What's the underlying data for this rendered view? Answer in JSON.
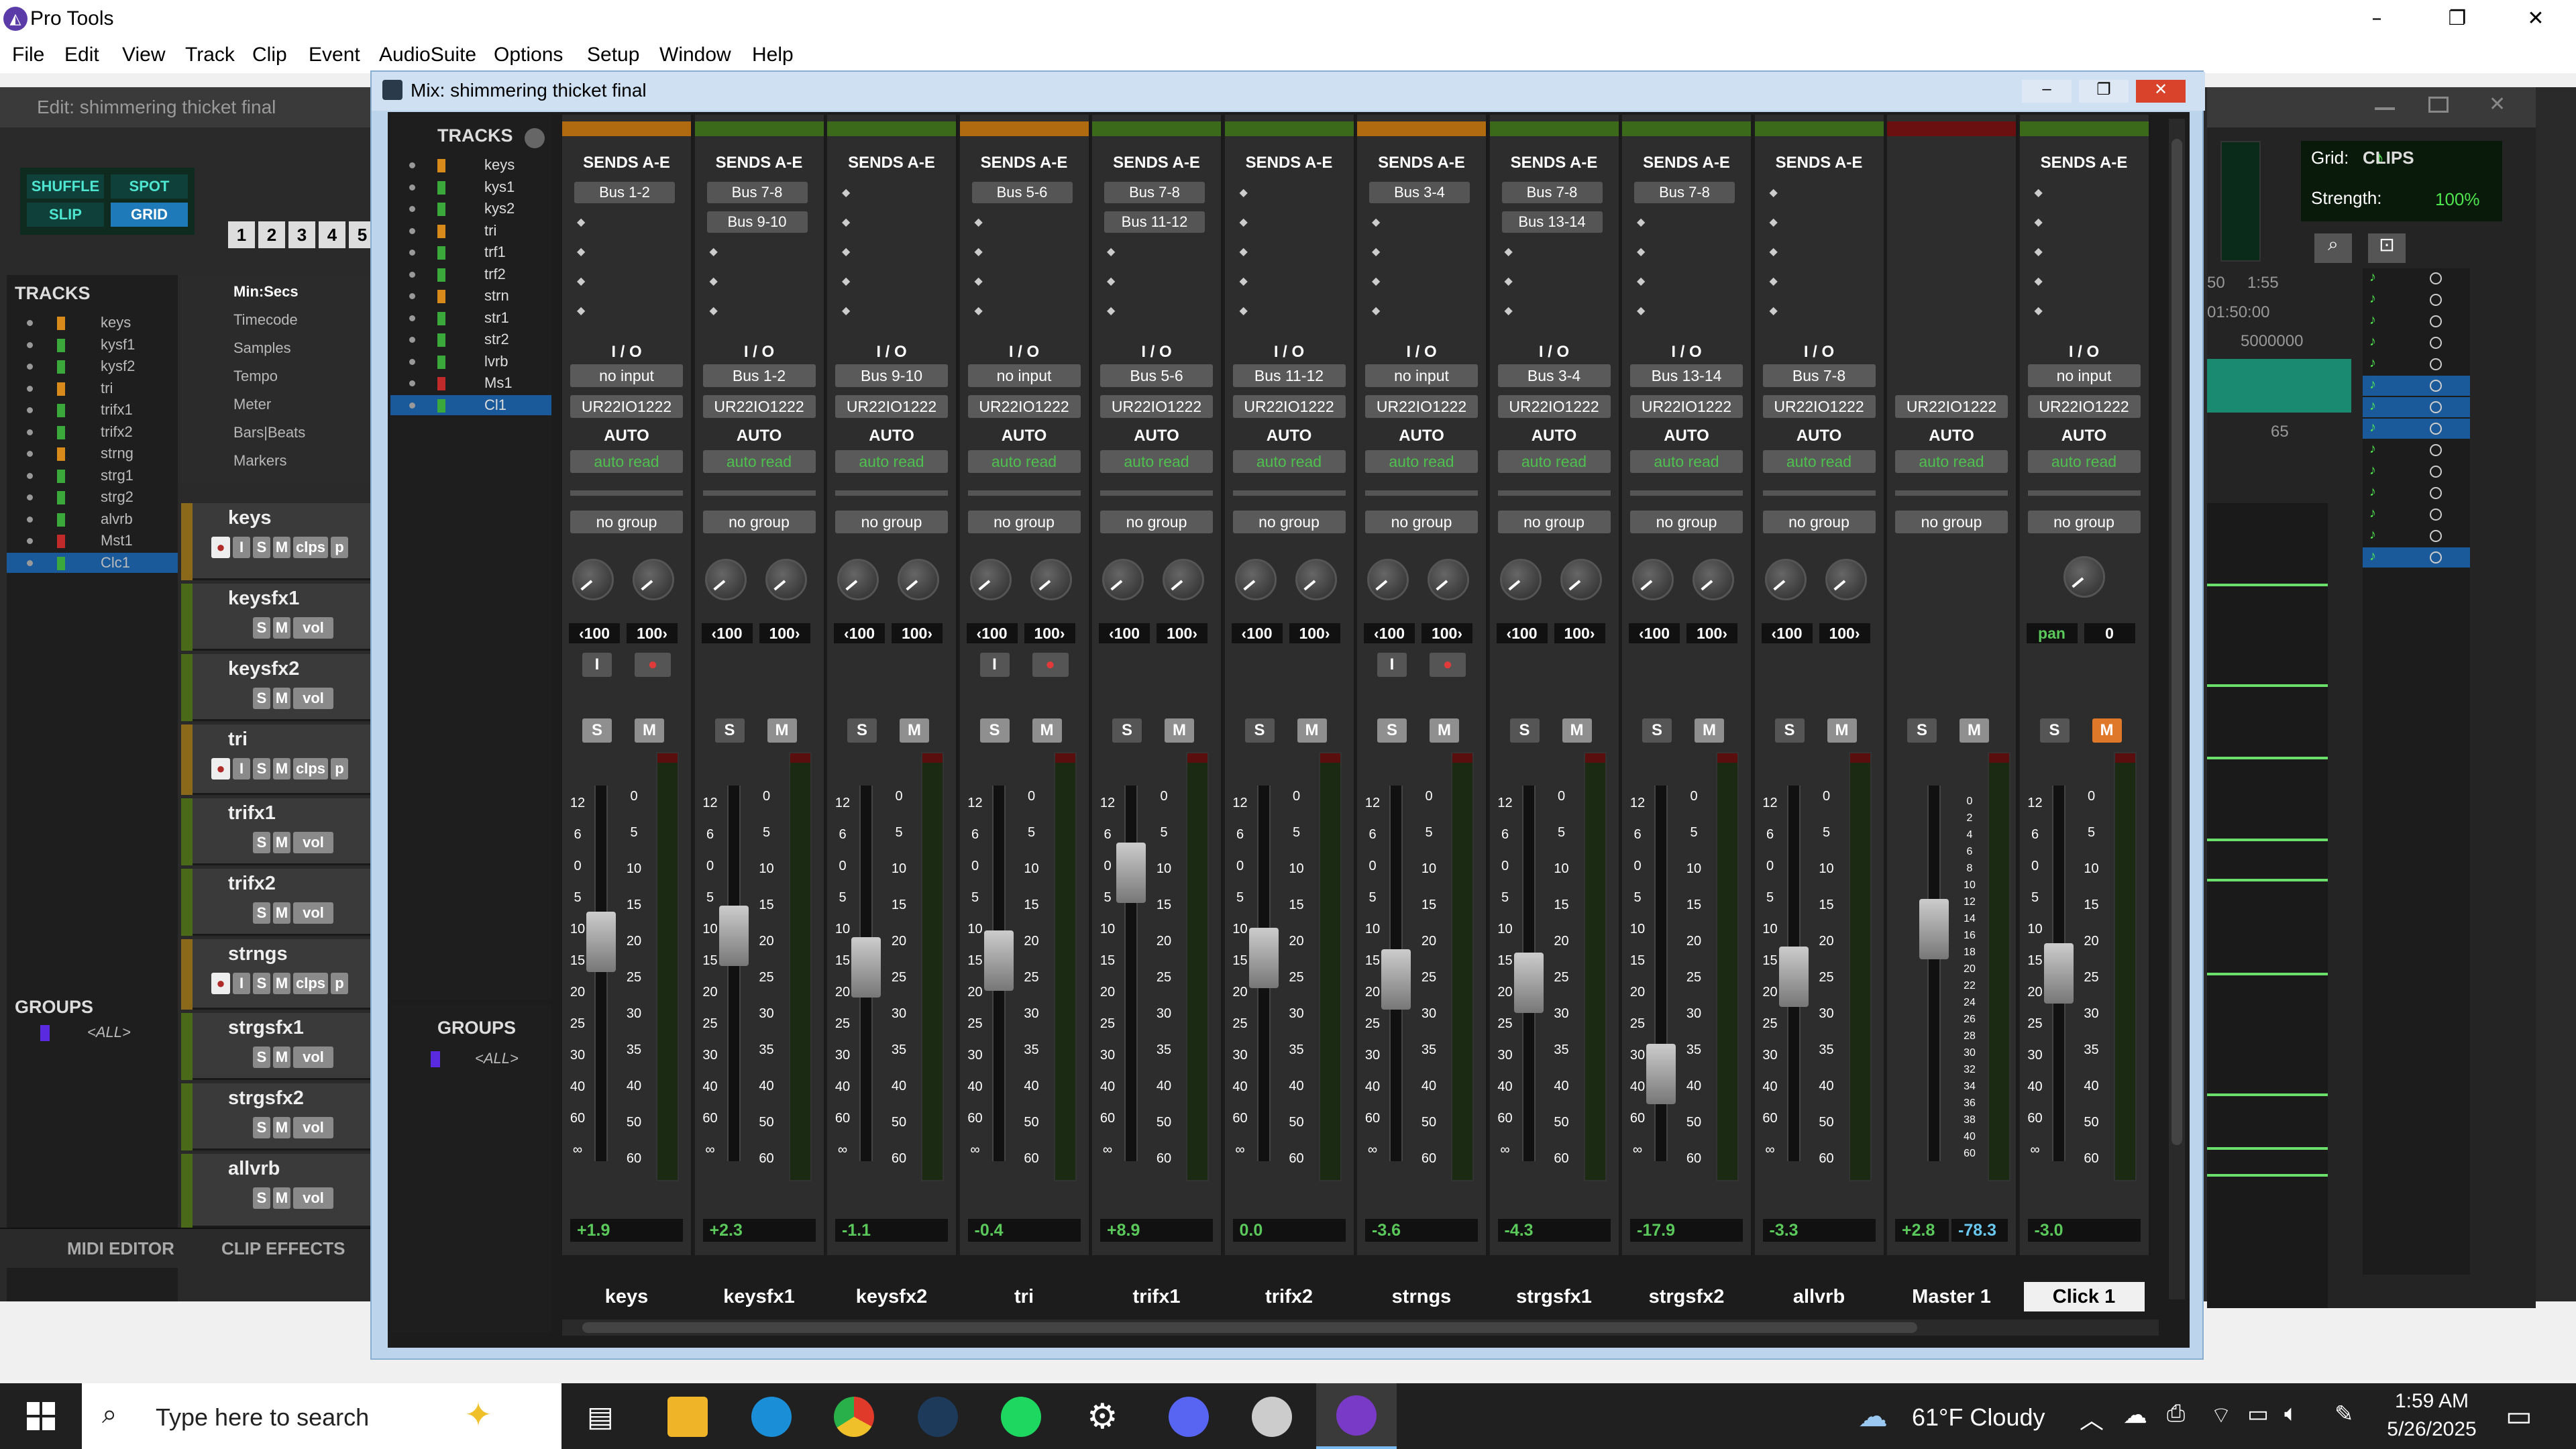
{
  "app": {
    "title": "Pro Tools",
    "edit_title": "Edit: shimmering thicket final",
    "mix_title": "Mix: shimmering thicket final"
  },
  "menu": [
    "File",
    "Edit",
    "View",
    "Track",
    "Clip",
    "Event",
    "AudioSuite",
    "Options",
    "Setup",
    "Window",
    "Help"
  ],
  "edit": {
    "modes": [
      "SHUFFLE",
      "SPOT",
      "SLIP",
      "GRID"
    ],
    "counts": [
      "1",
      "2",
      "3",
      "4",
      "5"
    ],
    "tracks_header": "TRACKS",
    "groups_header": "GROUPS",
    "group_all": "<ALL>",
    "left_tracks": [
      "keys",
      "kysf1",
      "kysf2",
      "tri",
      "trifx1",
      "trifx2",
      "strng",
      "strg1",
      "strg2",
      "alvrb",
      "Mst1",
      "Clc1"
    ],
    "rulers": [
      "Min:Secs",
      "Timecode",
      "Samples",
      "Tempo",
      "Meter",
      "Bars|Beats",
      "Markers"
    ],
    "track_names": [
      "keys",
      "keysfx1",
      "keysfx2",
      "tri",
      "trifx1",
      "trifx2",
      "strngs",
      "strgsfx1",
      "strgsfx2",
      "allvrb"
    ],
    "grid_label": "Grid:",
    "strength_label": "Strength:",
    "strength_value": "100%",
    "time_vals": [
      "1:55",
      "50",
      "01:50:00",
      "5000000",
      "65"
    ],
    "clips_header": "CLIPS",
    "bottom_tabs": [
      "MIDI EDITOR",
      "CLIP EFFECTS"
    ],
    "button_labels": {
      "i": "I",
      "s": "S",
      "m": "M",
      "clips": "clps",
      "p": "p",
      "vol": "vol"
    }
  },
  "mix": {
    "tracks_header": "TRACKS",
    "groups_header": "GROUPS",
    "group_all": "<ALL>",
    "tracks": [
      "keys",
      "kys1",
      "kys2",
      "tri",
      "trf1",
      "trf2",
      "strn",
      "str1",
      "str2",
      "lvrb",
      "Ms1",
      "Cl1"
    ],
    "sends_label": "SENDS A-E",
    "io_label": "I / O",
    "auto_label": "AUTO",
    "scale": [
      "12",
      "6",
      "0",
      "5",
      "10",
      "15",
      "20",
      "25",
      "30",
      "40",
      "60",
      "∞"
    ],
    "scale_right": [
      "0",
      "5",
      "10",
      "15",
      "20",
      "25",
      "30",
      "35",
      "40",
      "50",
      "60"
    ],
    "master_scale": [
      "0",
      "2",
      "4",
      "6",
      "8",
      "10",
      "12",
      "14",
      "16",
      "18",
      "20",
      "22",
      "24",
      "26",
      "28",
      "30",
      "32",
      "34",
      "36",
      "38",
      "40",
      "60"
    ],
    "strips": [
      {
        "name": "keys",
        "color": "#b06a10",
        "sends": [
          "Bus 1-2"
        ],
        "input": "no input",
        "output": "UR22IO1222",
        "auto": "auto read",
        "group": "no group",
        "pan_l": "‹100",
        "pan_r": "100›",
        "vol": "+1.9",
        "rec": true,
        "fader": 0.4
      },
      {
        "name": "keysfx1",
        "color": "#3a6a1a",
        "sends": [
          "Bus 7-8",
          "Bus 9-10"
        ],
        "input": "Bus 1-2",
        "output": "UR22IO1222",
        "auto": "auto read",
        "group": "no group",
        "pan_l": "‹100",
        "pan_r": "100›",
        "vol": "+2.3",
        "rec": false,
        "fader": 0.38
      },
      {
        "name": "keysfx2",
        "color": "#3a6a1a",
        "sends": [],
        "input": "Bus 9-10",
        "output": "UR22IO1222",
        "auto": "auto read",
        "group": "no group",
        "pan_l": "‹100",
        "pan_r": "100›",
        "vol": "-1.1",
        "rec": false,
        "fader": 0.48
      },
      {
        "name": "tri",
        "color": "#b06a10",
        "sends": [
          "Bus 5-6"
        ],
        "input": "no input",
        "output": "UR22IO1222",
        "auto": "auto read",
        "group": "no group",
        "pan_l": "‹100",
        "pan_r": "100›",
        "vol": "-0.4",
        "rec": true,
        "fader": 0.46
      },
      {
        "name": "trifx1",
        "color": "#3a6a1a",
        "sends": [
          "Bus 7-8",
          "Bus 11-12"
        ],
        "input": "Bus 5-6",
        "output": "UR22IO1222",
        "auto": "auto read",
        "group": "no group",
        "pan_l": "‹100",
        "pan_r": "100›",
        "vol": "+8.9",
        "rec": false,
        "fader": 0.18
      },
      {
        "name": "trifx2",
        "color": "#3a6a1a",
        "sends": [],
        "input": "Bus 11-12",
        "output": "UR22IO1222",
        "auto": "auto read",
        "group": "no group",
        "pan_l": "‹100",
        "pan_r": "100›",
        "vol": "0.0",
        "rec": false,
        "fader": 0.45
      },
      {
        "name": "strngs",
        "color": "#b06a10",
        "sends": [
          "Bus 3-4"
        ],
        "input": "no input",
        "output": "UR22IO1222",
        "auto": "auto read",
        "group": "no group",
        "pan_l": "‹100",
        "pan_r": "100›",
        "vol": "-3.6",
        "rec": true,
        "fader": 0.52
      },
      {
        "name": "strgsfx1",
        "color": "#3a6a1a",
        "sends": [
          "Bus 7-8",
          "Bus 13-14"
        ],
        "input": "Bus 3-4",
        "output": "UR22IO1222",
        "auto": "auto read",
        "group": "no group",
        "pan_l": "‹100",
        "pan_r": "100›",
        "vol": "-4.3",
        "rec": false,
        "fader": 0.53
      },
      {
        "name": "strgsfx2",
        "color": "#3a6a1a",
        "sends": [
          "Bus 7-8"
        ],
        "input": "Bus 13-14",
        "output": "UR22IO1222",
        "auto": "auto read",
        "group": "no group",
        "pan_l": "‹100",
        "pan_r": "100›",
        "vol": "-17.9",
        "rec": false,
        "fader": 0.82
      },
      {
        "name": "allvrb",
        "color": "#3a6a1a",
        "sends": [],
        "input": "Bus 7-8",
        "output": "UR22IO1222",
        "auto": "auto read",
        "group": "no group",
        "pan_l": "‹100",
        "pan_r": "100›",
        "vol": "-3.3",
        "rec": false,
        "fader": 0.51
      },
      {
        "name": "Master 1",
        "color": "#6a1010",
        "sends": null,
        "input": "",
        "output": "UR22IO1222",
        "auto": "auto read",
        "group": "no group",
        "pan_l": "",
        "pan_r": "",
        "vol": "+2.8",
        "vol2": "-78.3",
        "rec": false,
        "fader": 0.36
      },
      {
        "name": "Click 1",
        "color": "#3a6a1a",
        "sends": [],
        "input": "no input",
        "output": "UR22IO1222",
        "auto": "auto read",
        "group": "no group",
        "pan_l": "pan",
        "pan_r": "0",
        "vol": "-3.0",
        "rec": false,
        "fader": 0.5,
        "muted": true
      }
    ]
  },
  "taskbar": {
    "search_placeholder": "Type here to search",
    "weather": "61°F  Cloudy",
    "time": "1:59 AM",
    "date": "5/26/2025"
  }
}
